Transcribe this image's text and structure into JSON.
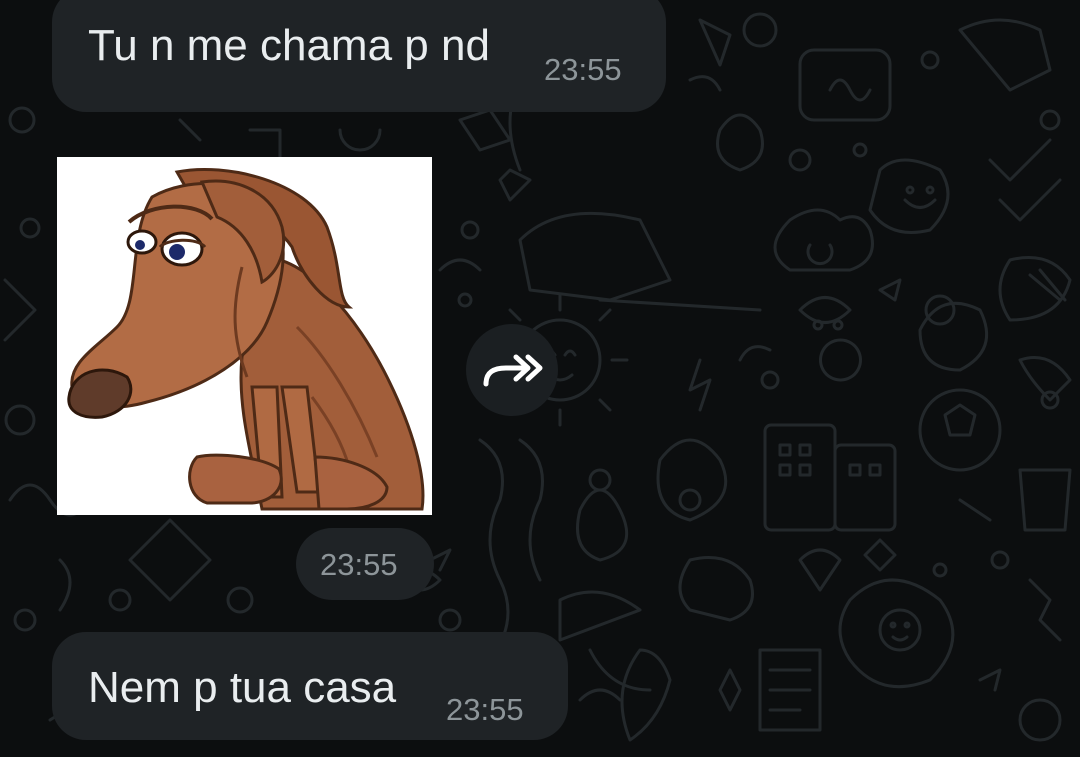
{
  "messages": [
    {
      "text": "Tu n me chama p nd",
      "time": "23:55"
    },
    {
      "sticker": "sad-brown-dog",
      "time": "23:55"
    },
    {
      "text": "Nem p tua casa",
      "time": "23:55"
    }
  ],
  "icons": {
    "forward": "double-arrow-forward-icon"
  },
  "colors": {
    "background": "#0c0e0f",
    "bubble": "#1f2326",
    "message_text": "#e9edef",
    "timestamp": "#8d9599"
  }
}
